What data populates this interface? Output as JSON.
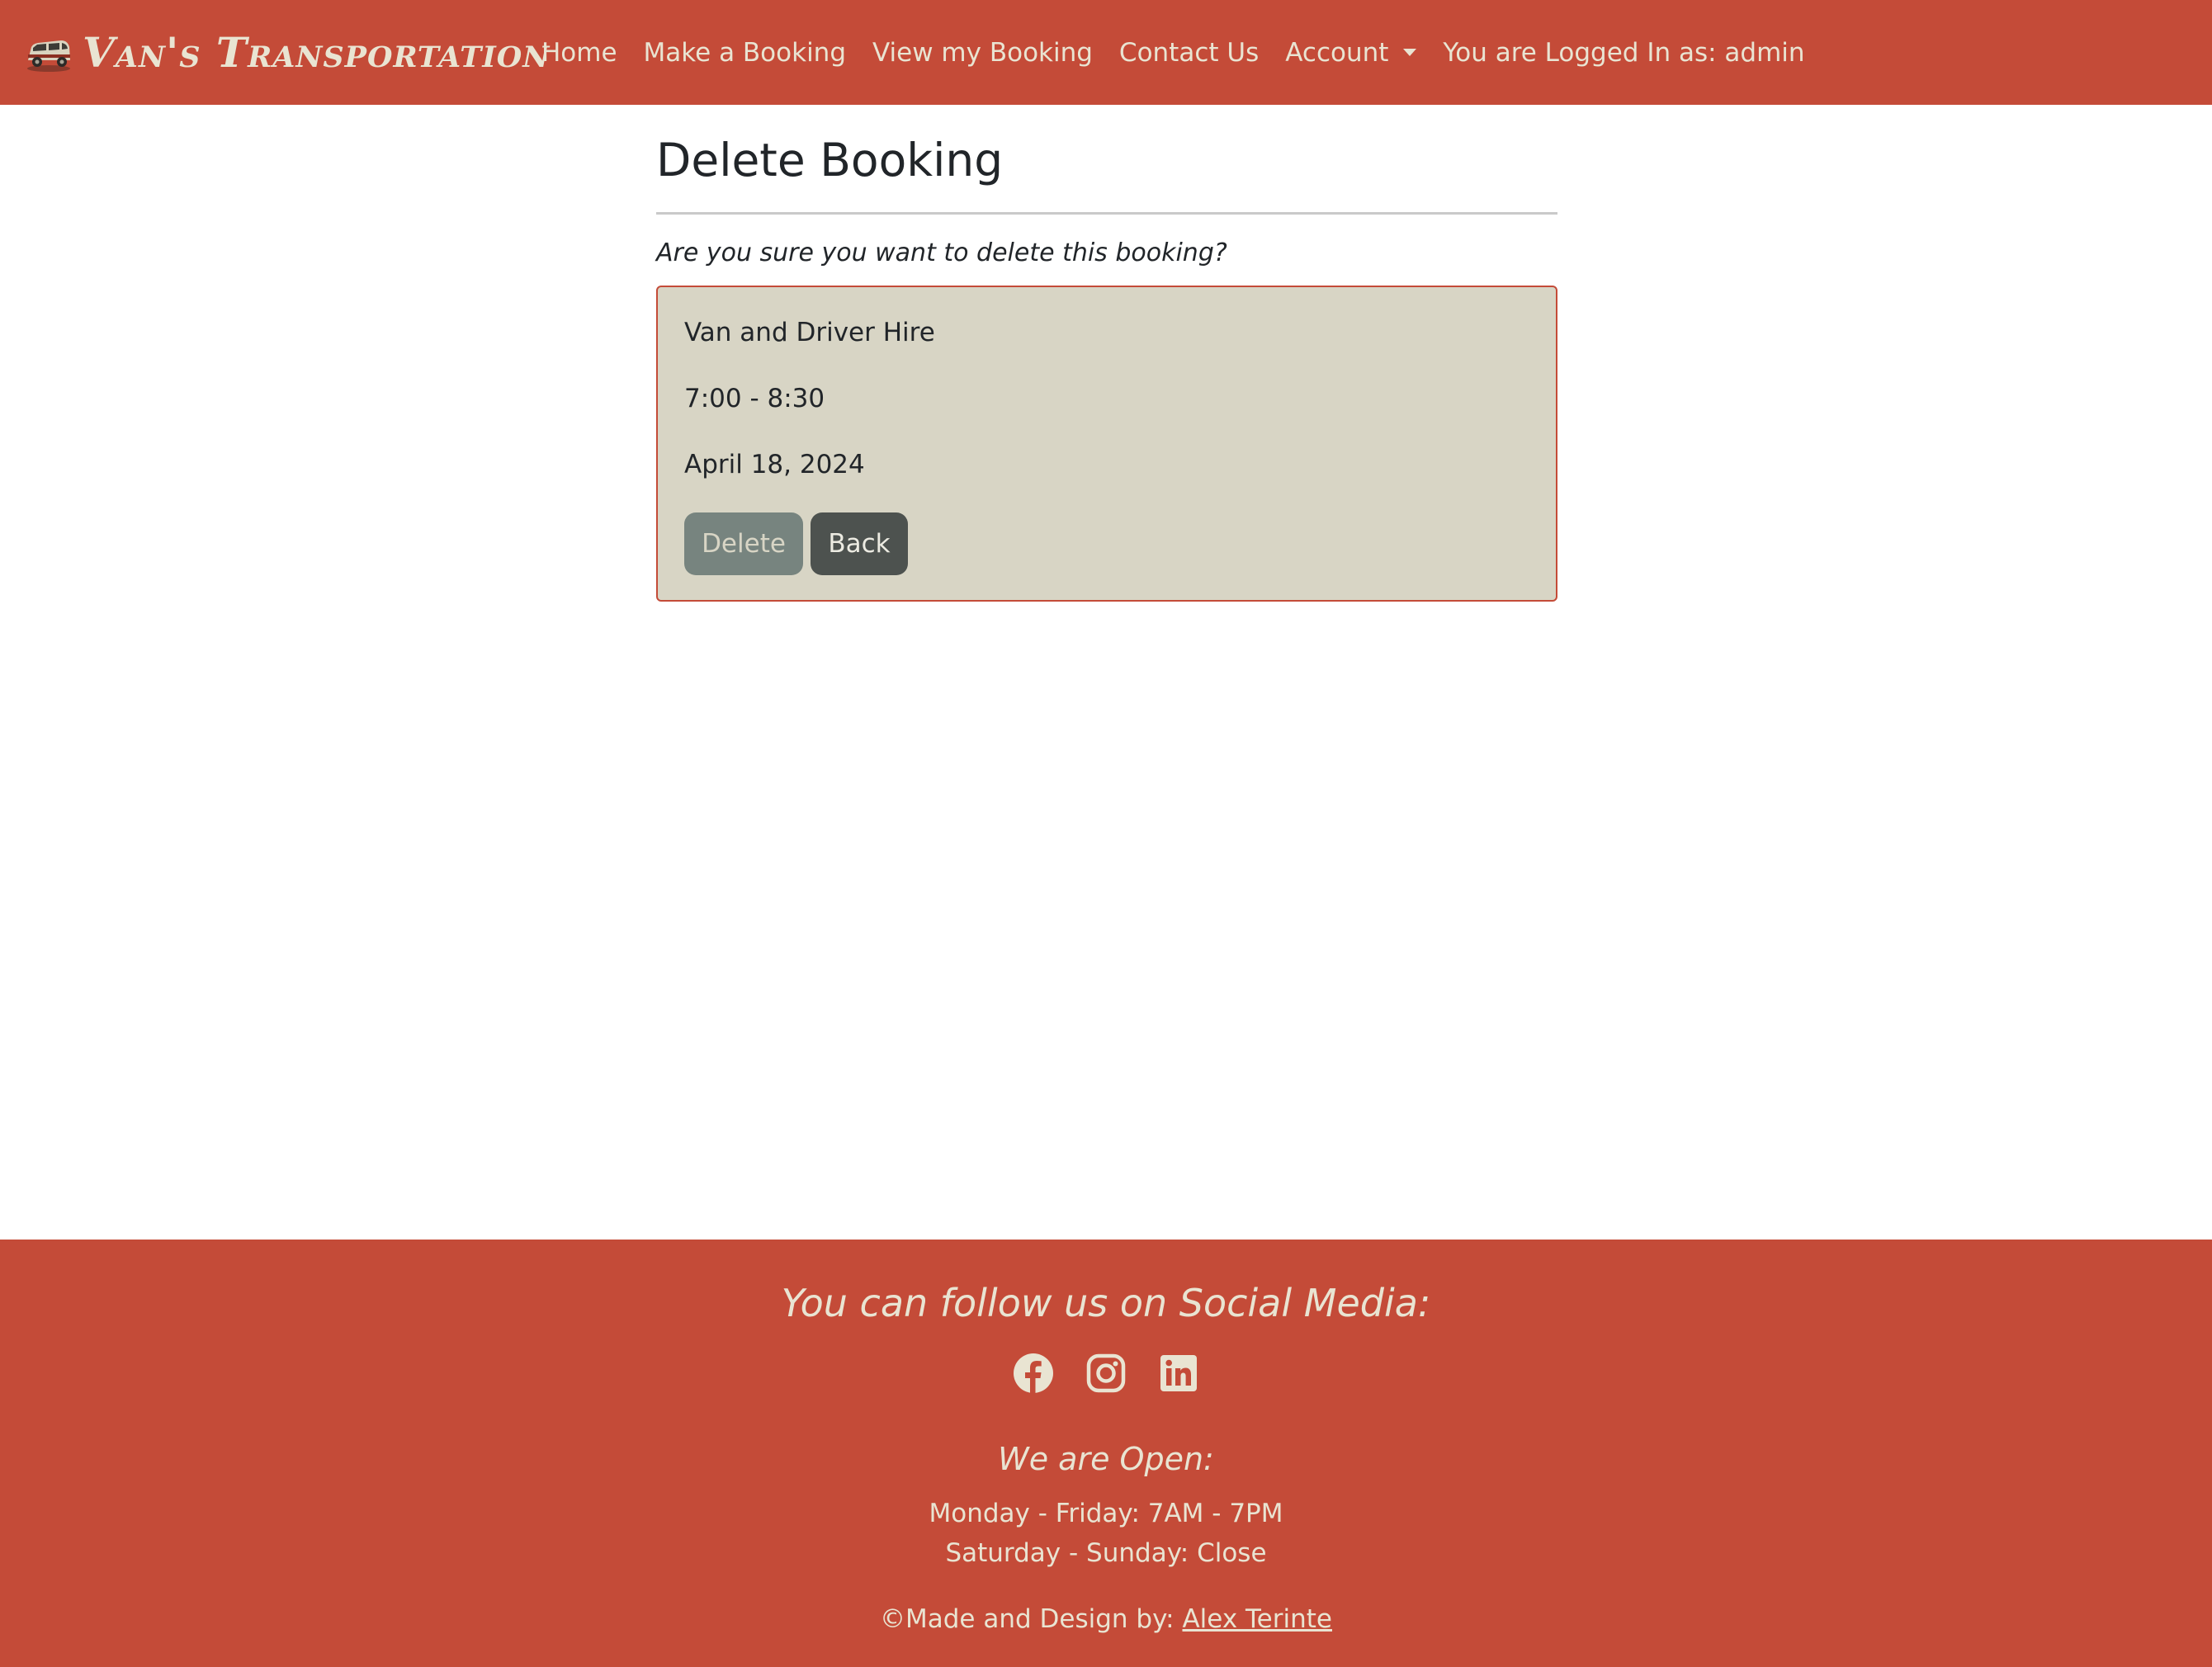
{
  "navbar": {
    "brand": "Van's Transportation",
    "brand_logo_icon": "van-icon",
    "links": [
      {
        "label": "Home"
      },
      {
        "label": "Make a Booking"
      },
      {
        "label": "View my Booking"
      },
      {
        "label": "Contact Us"
      },
      {
        "label": "Account"
      }
    ],
    "status": "You are Logged In as: admin"
  },
  "main": {
    "title": "Delete Booking",
    "prompt": "Are you sure you want to delete this booking?",
    "booking": {
      "service": "Van and Driver Hire",
      "time": "7:00 - 8:30",
      "date": "April 18, 2024"
    },
    "delete_label": "Delete",
    "back_label": "Back"
  },
  "footer": {
    "follow_title": "You can follow us on Social Media:",
    "social_icons": [
      "facebook-icon",
      "instagram-icon",
      "linkedin-icon"
    ],
    "open_title": "We are Open:",
    "hours_weekday": "Monday - Friday: 7AM - 7PM",
    "hours_weekend": "Saturday - Sunday: Close",
    "credit_prefix": "©Made and Design by: ",
    "credit_name": "Alex Terinte"
  },
  "colors": {
    "brand": "#c44b38",
    "text_light": "#e9e4d2",
    "card_bg": "#d8d5c5",
    "delete_bg": "#77847f",
    "back_bg": "#4d524f"
  }
}
